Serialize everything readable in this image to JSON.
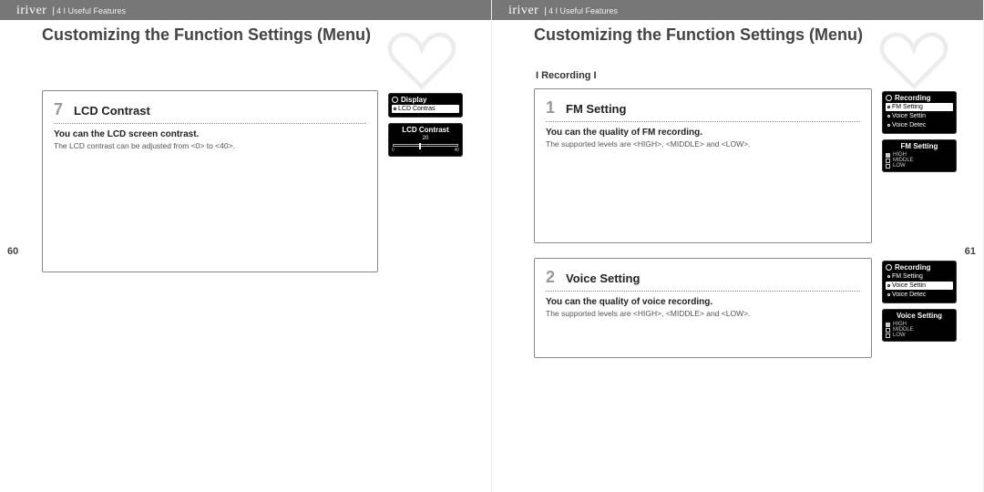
{
  "brand": "iriver",
  "breadcrumb": "4 I Useful Features",
  "pageTitle": "Customizing the Function Settings (Menu)",
  "left": {
    "pageNumber": "60",
    "block": {
      "num": "7",
      "title": "LCD Contrast",
      "lead": "You can the LCD screen contrast.",
      "fine": "The LCD contrast can be adjusted from <0> to <40>.",
      "dev1": {
        "header": "Display",
        "selected": "LCD Contras"
      },
      "dev2": {
        "title": "LCD Contrast",
        "value": "20",
        "min": "0",
        "max": "40"
      }
    }
  },
  "right": {
    "pageNumber": "61",
    "sectionLabel": "I Recording I",
    "block1": {
      "num": "1",
      "title": "FM Setting",
      "lead": "You can the quality of FM recording.",
      "fine": "The supported levels are <HIGH>, <MIDDLE> and <LOW>.",
      "dev1": {
        "header": "Recording",
        "rows": [
          "FM Setting",
          "Voice Settin",
          "Voice Detec"
        ],
        "selectedIndex": 0
      },
      "dev2": {
        "title": "FM Setting",
        "options": [
          "HIGH",
          "MIDDLE",
          "LOW"
        ],
        "selectedIndex": 0
      }
    },
    "block2": {
      "num": "2",
      "title": "Voice Setting",
      "lead": "You can the quality of voice recording.",
      "fine": "The supported levels are <HIGH>, <MIDDLE> and <LOW>.",
      "dev1": {
        "header": "Recording",
        "rows": [
          "FM Setting",
          "Voice Settin",
          "Voice Detec"
        ],
        "selectedIndex": 1
      },
      "dev2": {
        "title": "Voice Setting",
        "options": [
          "HIGH",
          "MIDDLE",
          "LOW"
        ],
        "selectedIndex": 0
      }
    }
  }
}
